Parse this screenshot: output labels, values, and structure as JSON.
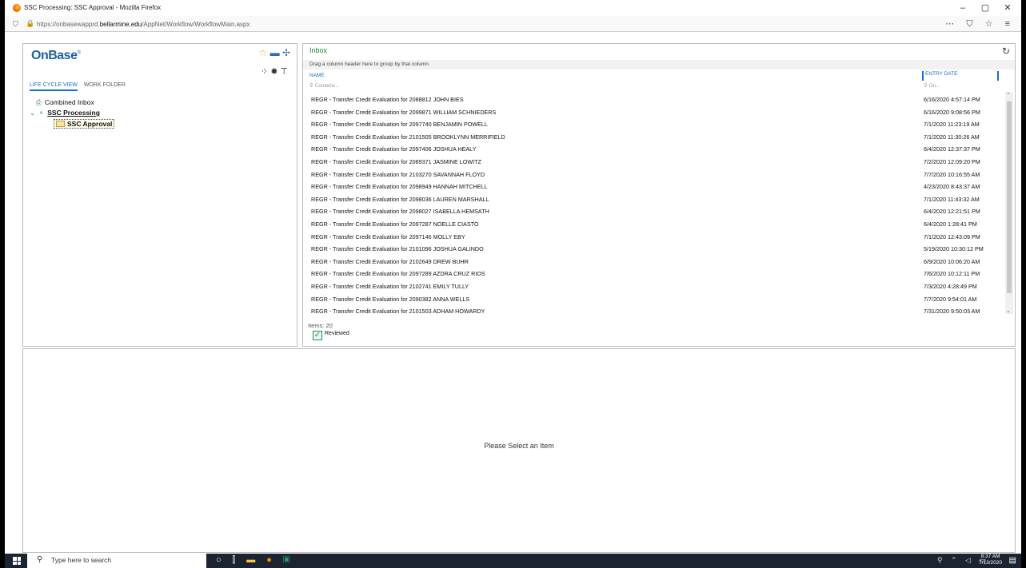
{
  "window": {
    "title": "SSC Processing: SSC Approval - Mozilla Firefox",
    "url_prefix": "https://onbasewapprd.",
    "url_domain": "bellarmine.edu",
    "url_path": "/AppNet/Workflow/WorkflowMain.aspx",
    "min": "–",
    "max": "▢",
    "close": "✕"
  },
  "left": {
    "logo": "OnBase",
    "logo_mark": "®",
    "tab_lifecycle": "LIFE CYCLE VIEW",
    "tab_workfolder": "WORK FOLDER",
    "combined_inbox": "Combined Inbox",
    "ssc_processing": "SSC Processing",
    "ssc_approval": "SSC Approval"
  },
  "inbox": {
    "title": "Inbox",
    "drag_hint": "Drag a column header here to group by that column.",
    "col_name": "NAME",
    "col_date": "ENTRY DATE",
    "filter_name": "⊽ Contains...",
    "filter_date": "⊽ On...",
    "items": "Items: 20",
    "reviewed": "Reviewed",
    "rows": [
      {
        "name": "REGR - Transfer Credit Evaluation for 2088812 JOHN BIES",
        "date": "6/16/2020 4:57:14 PM"
      },
      {
        "name": "REGR - Transfer Credit Evaluation for 2099871 WILLIAM SCHNIEDERS",
        "date": "6/16/2020 9:08:56 PM"
      },
      {
        "name": "REGR - Transfer Credit Evaluation for 2097740 BENJAMIN POWELL",
        "date": "7/1/2020 11:23:19 AM"
      },
      {
        "name": "REGR - Transfer Credit Evaluation for 2101505 BROOKLYNN MERRIFIELD",
        "date": "7/1/2020 11:30:26 AM"
      },
      {
        "name": "REGR - Transfer Credit Evaluation for 2097406 JOSHUA HEALY",
        "date": "6/4/2020 12:37:37 PM"
      },
      {
        "name": "REGR - Transfer Credit Evaluation for 2089371 JASMINE LOWITZ",
        "date": "7/2/2020 12:09:20 PM"
      },
      {
        "name": "REGR - Transfer Credit Evaluation for 2103270 SAVANNAH FLOYD",
        "date": "7/7/2020 10:16:55 AM"
      },
      {
        "name": "REGR - Transfer Credit Evaluation for 2098949 HANNAH MITCHELL",
        "date": "4/23/2020 8:43:37 AM"
      },
      {
        "name": "REGR - Transfer Credit Evaluation for 2098036 LAUREN MARSHALL",
        "date": "7/1/2020 11:43:32 AM"
      },
      {
        "name": "REGR - Transfer Credit Evaluation for 2098027 ISABELLA HEMSATH",
        "date": "6/4/2020 12:21:51 PM"
      },
      {
        "name": "REGR - Transfer Credit Evaluation for 2097287 NOELLE CIASTO",
        "date": "6/4/2020 1:28:41 PM"
      },
      {
        "name": "REGR - Transfer Credit Evaluation for 2097146 MOLLY EBY",
        "date": "7/1/2020 12:43:09 PM"
      },
      {
        "name": "REGR - Transfer Credit Evaluation for 2101096 JOSHUA GALINDO",
        "date": "5/19/2020 10:30:12 PM"
      },
      {
        "name": "REGR - Transfer Credit Evaluation for 2102649 DREW BUHR",
        "date": "6/9/2020 10:06:20 AM"
      },
      {
        "name": "REGR - Transfer Credit Evaluation for 2097289 AZDRA CRUZ RIOS",
        "date": "7/6/2020 10:12:11 PM"
      },
      {
        "name": "REGR - Transfer Credit Evaluation for 2102741 EMILY TULLY",
        "date": "7/3/2020 4:28:49 PM"
      },
      {
        "name": "REGR - Transfer Credit Evaluation for 2090382 ANNA WELLS",
        "date": "7/7/2020 9:54:01 AM"
      },
      {
        "name": "REGR - Transfer Credit Evaluation for 2101503 ADHAM HOWARDY",
        "date": "7/31/2020 9:50:03 AM"
      }
    ]
  },
  "viewer": {
    "placeholder": "Please Select an Item"
  },
  "taskbar": {
    "search_placeholder": "Type here to search",
    "time": "8:37 AM",
    "date": "7/13/2020"
  }
}
